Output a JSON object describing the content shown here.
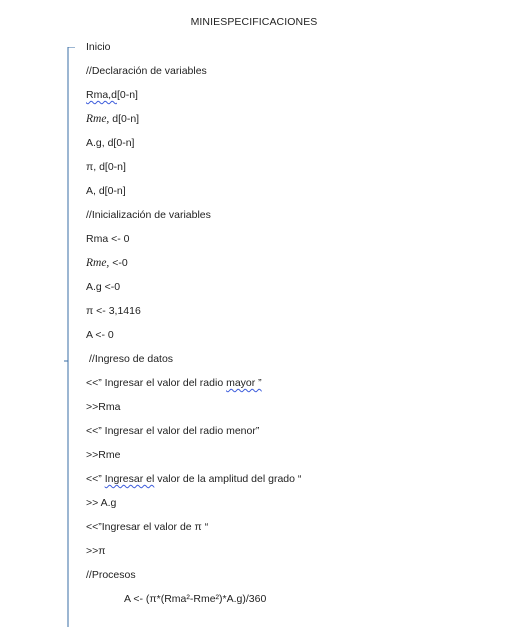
{
  "document": {
    "title": "MINIESPECIFICACIONES",
    "lines": [
      {
        "text": "Inicio"
      },
      {
        "text": "//Declaración de variables"
      },
      {
        "pre": "",
        "squiggle": "Rma,d",
        "post": "[0-n]"
      },
      {
        "italic": "Rme,",
        "post": " d[0-n]"
      },
      {
        "text": "A.g, d[0-n]"
      },
      {
        "text": "π, d[0-n]"
      },
      {
        "text": "A, d[0-n]"
      },
      {
        "text": "//Inicialización de variables"
      },
      {
        "text": "Rma <- 0"
      },
      {
        "italic": "Rme,",
        "post": " <-0"
      },
      {
        "text": "A.g <-0"
      },
      {
        "text": "π <- 3,1416"
      },
      {
        "text": "A <- 0"
      },
      {
        "text": "//Ingreso de datos"
      },
      {
        "pre": "<<” Ingresar el valor del radio ",
        "squiggle": "mayor  ”",
        "post": ""
      },
      {
        "text": ">>Rma"
      },
      {
        "text": "<<” Ingresar el valor del radio menor”"
      },
      {
        "text": ">>Rme"
      },
      {
        "pre": "<<” ",
        "squiggle": "Ingresar  el",
        "post": " valor de la amplitud del grado “"
      },
      {
        "text": ">> A.g"
      },
      {
        "text": "<<”Ingresar el valor de π “"
      },
      {
        "text": ">>π"
      },
      {
        "text": "//Procesos"
      },
      {
        "text": "A <- (π*(Rma²-Rme²)*A.g)/360"
      }
    ]
  }
}
